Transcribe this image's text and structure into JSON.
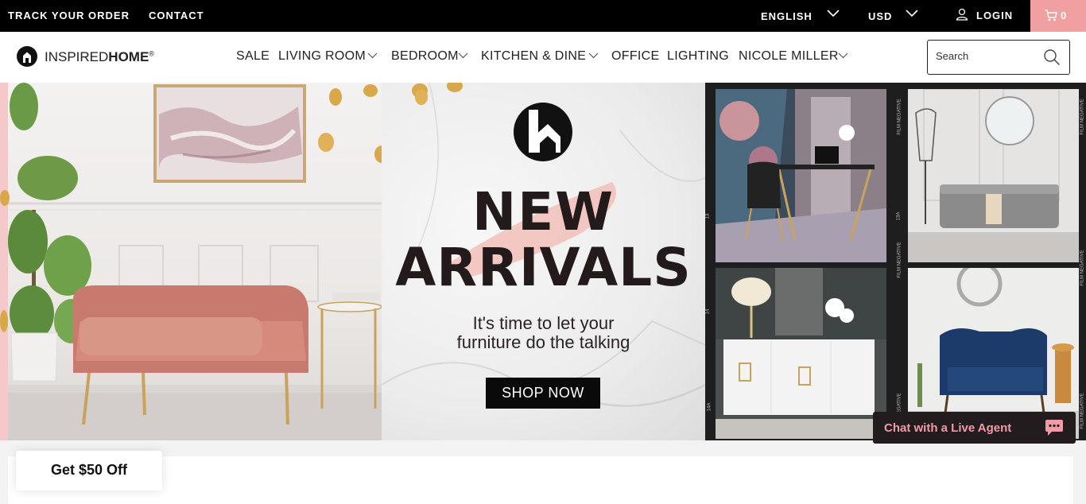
{
  "topbar": {
    "track_order": "TRACK YOUR ORDER",
    "contact": "CONTACT",
    "language": "ENGLISH",
    "currency": "USD",
    "login": "LOGIN",
    "cart_count": "0"
  },
  "header": {
    "logo_text_light": "INSPIRED",
    "logo_text_bold": "HOME",
    "logo_mark": "®",
    "nav": [
      {
        "label": "SALE",
        "dropdown": false
      },
      {
        "label": "LIVING ROOM",
        "dropdown": true
      },
      {
        "label": "BEDROOM",
        "dropdown": true
      },
      {
        "label": "KITCHEN & DINE",
        "dropdown": true
      },
      {
        "label": "OFFICE",
        "dropdown": false
      },
      {
        "label": "LIGHTING",
        "dropdown": false
      },
      {
        "label": "NICOLE MILLER",
        "dropdown": true
      }
    ],
    "search_placeholder": "Search"
  },
  "hero": {
    "title_line1": "NEW",
    "title_line2": "ARRIVALS",
    "subtitle_line1": "It's time to let your",
    "subtitle_line2": "furniture do the talking",
    "cta": "SHOP NOW",
    "film_label": "FILM NEGATIVE",
    "frame_labels": [
      "13",
      "13A",
      "14",
      "14A"
    ]
  },
  "promo": {
    "discount": "Get $50 Off"
  },
  "chat": {
    "label": "Chat with a Live Agent"
  },
  "colors": {
    "accent_pink": "#f0a0a0",
    "chat_text": "#f29aa6",
    "dark": "#231c1e"
  },
  "icons": [
    "user-icon",
    "cart-icon",
    "search-icon",
    "chevron-down-icon",
    "chat-bubble-icon",
    "brand-logo-icon"
  ]
}
